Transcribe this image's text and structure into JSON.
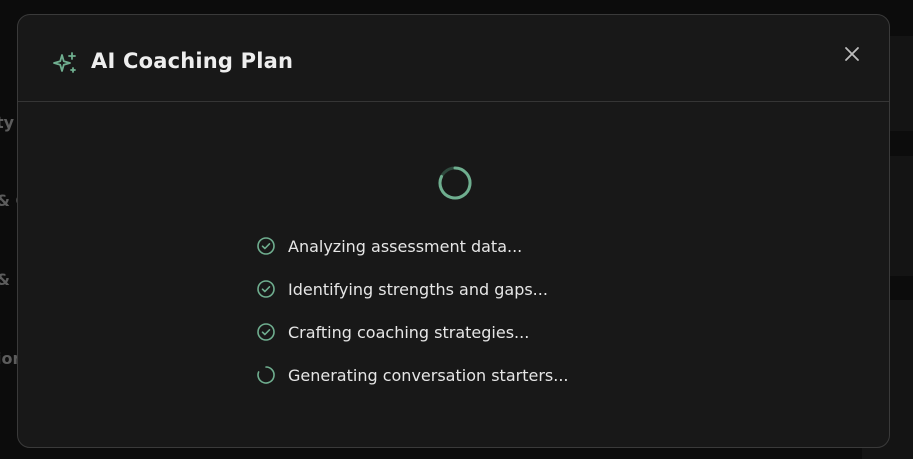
{
  "background": {
    "rows": [
      {
        "text": "ty"
      },
      {
        "text": "& C"
      },
      {
        "text": "&"
      },
      {
        "text": "ion"
      }
    ]
  },
  "modal": {
    "title": "AI Coaching Plan",
    "title_icon": "sparkles-icon",
    "close_icon": "close-icon",
    "spinner_icon": "loading-spinner-icon",
    "accent_color": "#6fae8f",
    "steps": [
      {
        "label": "Analyzing assessment data...",
        "status": "complete",
        "icon": "check-circle-icon"
      },
      {
        "label": "Identifying strengths and gaps...",
        "status": "complete",
        "icon": "check-circle-icon"
      },
      {
        "label": "Crafting coaching strategies...",
        "status": "complete",
        "icon": "check-circle-icon"
      },
      {
        "label": "Generating conversation starters...",
        "status": "in-progress",
        "icon": "loading-spinner-icon"
      }
    ]
  }
}
